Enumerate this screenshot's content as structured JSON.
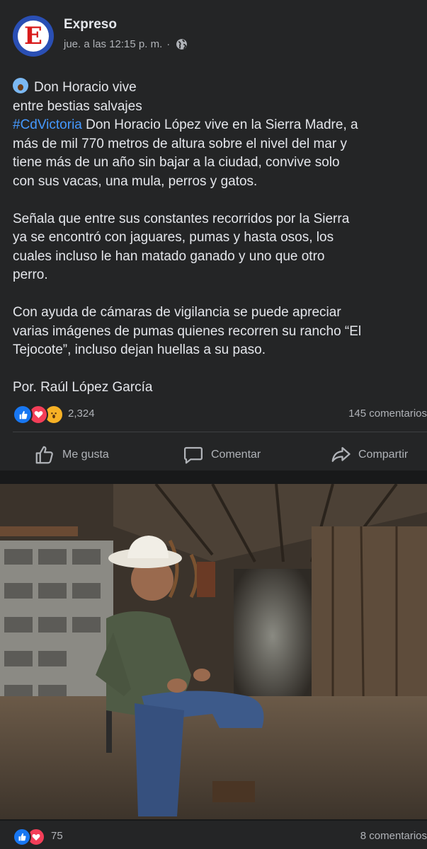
{
  "post": {
    "page_name": "Expreso",
    "avatar_letter": "E",
    "timestamp": "jue. a las 12:15 p. m.",
    "separator": "·",
    "privacy_icon": "globe-icon",
    "text": {
      "line1": "Don Horacio vive",
      "line2": "entre bestias salvajes",
      "hashtag": "#CdVictoria",
      "p1_rest_line1": " Don Horacio López vive en la Sierra Madre, a",
      "p1_line2": "más de mil 770 metros de altura sobre el nivel del mar y",
      "p1_line3": "tiene más de un año sin bajar a la ciudad, convive solo",
      "p1_line4": "con sus vacas, una mula, perros y gatos.",
      "p2_line1": "Señala que entre sus constantes recorridos por la Sierra",
      "p2_line2": "ya se encontró  con jaguares, pumas y hasta osos, los",
      "p2_line3": "cuales incluso le han matado ganado y uno que otro",
      "p2_line4": "perro.",
      "p3_line1": "Con ayuda de cámaras de vigilancia se puede apreciar",
      "p3_line2": "varias imágenes de pumas quienes recorren su rancho “El",
      "p3_line3": "Tejocote”, incluso dejan huellas a su paso.",
      "byline": "Por. Raúl López García"
    },
    "reactions": {
      "count": "2,324",
      "types": [
        "like-icon",
        "love-icon",
        "wow-icon"
      ]
    },
    "comments_count": "145 comentarios",
    "actions": {
      "like": "Me gusta",
      "comment": "Comentar",
      "share": "Compartir"
    }
  },
  "photo": {
    "subject": "photo-man-in-cowboy-hat"
  },
  "footer": {
    "reactions_count": "75",
    "comments_count": "8 comentarios"
  },
  "colors": {
    "background": "#18191a",
    "card": "#242526",
    "text": "#e4e6eb",
    "secondary": "#b0b3b8",
    "hashtag": "#4599ff",
    "like": "#1877f2",
    "love": "#f33e58",
    "wow": "#f7b125",
    "avatar_ring": "#2a4fb4",
    "avatar_letter": "#d81b1b"
  }
}
